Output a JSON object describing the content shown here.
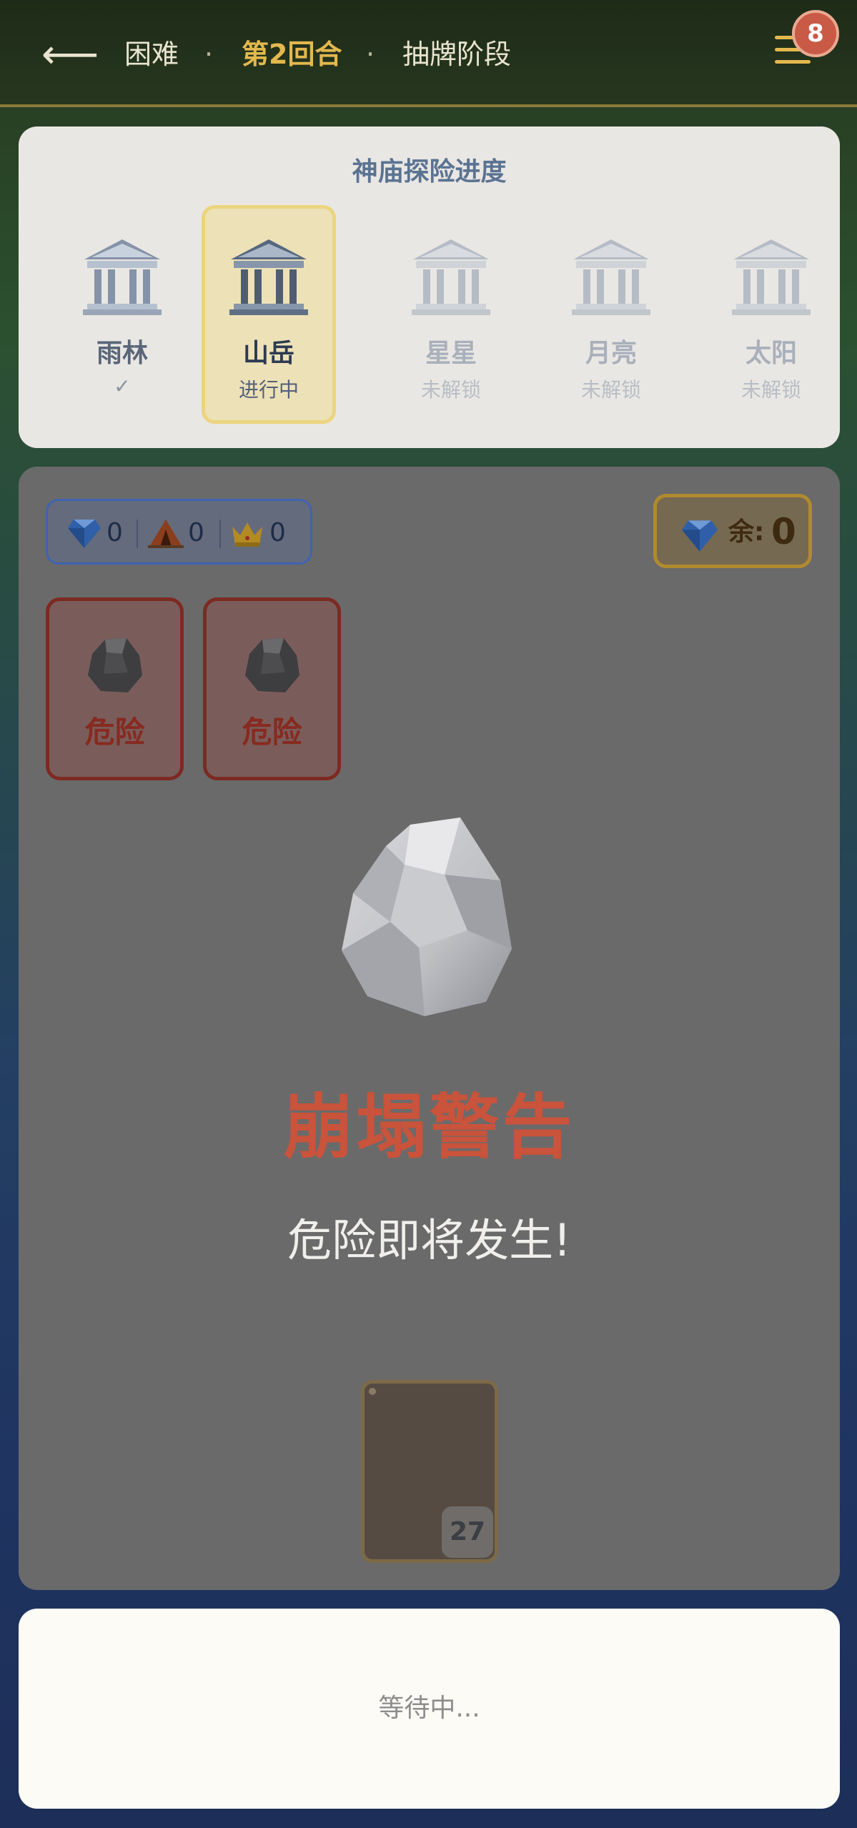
{
  "header": {
    "back_icon": "arrow-left-icon",
    "difficulty": "困难",
    "separator": "·",
    "round": "第2回合",
    "phase": "抽牌阶段",
    "menu_icon": "hamburger-menu-icon",
    "menu_badge": "8",
    "accent_color": "#e3b84e"
  },
  "progress": {
    "title": "神庙探险进度",
    "temples": [
      {
        "name": "雨林",
        "status": "✓",
        "state": "completed"
      },
      {
        "name": "山岳",
        "status": "进行中",
        "state": "active"
      },
      {
        "name": "星星",
        "status": "未解锁",
        "state": "locked"
      },
      {
        "name": "月亮",
        "status": "未解锁",
        "state": "locked"
      },
      {
        "name": "太阳",
        "status": "未解锁",
        "state": "locked"
      }
    ]
  },
  "game": {
    "stats": [
      {
        "icon": "gem-icon",
        "value": "0"
      },
      {
        "icon": "tent-icon",
        "value": "0"
      },
      {
        "icon": "crown-icon",
        "value": "0"
      }
    ],
    "remaining": {
      "icon": "gem-icon",
      "label": "余:",
      "value": "0"
    },
    "hazard_cards": [
      {
        "icon": "rock-icon",
        "label": "危险"
      },
      {
        "icon": "rock-icon",
        "label": "危险"
      }
    ],
    "event_icon": "boulder-icon",
    "warning_title": "崩塌警告",
    "warning_subtitle": "危险即将发生!",
    "deck_count": "27",
    "warning_color": "#c9533b"
  },
  "footer": {
    "status_text": "等待中..."
  }
}
